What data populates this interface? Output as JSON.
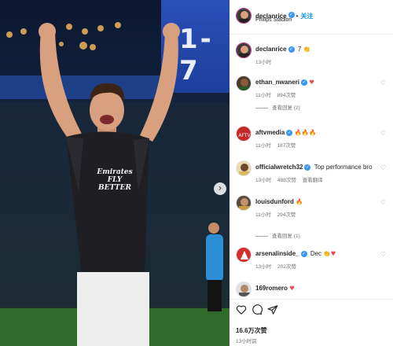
{
  "photo": {
    "scoreboard_text": "1-7",
    "jersey_sponsor": "Emirates FLY BETTER",
    "next_icon": "chevron-right-icon"
  },
  "header": {
    "username": "declanrice",
    "separator": "•",
    "follow_label": "关注",
    "location": "Philips Stadion"
  },
  "comments": [
    {
      "user": "declanrice",
      "text": "7",
      "emoji": "👏",
      "time": "13小时",
      "likes": "",
      "reply": "",
      "view_replies": ""
    },
    {
      "user": "ethan_nwaneri",
      "text": "",
      "emoji": "♥",
      "time": "11小时",
      "likes": "894次赞",
      "reply": "",
      "view_replies": "查看回复 (2)"
    },
    {
      "user": "aftvmedia",
      "text": "",
      "emoji": "🔥🔥🔥",
      "time": "11小时",
      "likes": "187次赞",
      "reply": "",
      "view_replies": ""
    },
    {
      "user": "officialwretch32",
      "text": "Top performance bro",
      "emoji": "",
      "time": "13小时",
      "likes": "488次赞",
      "reply": "查看翻译",
      "view_replies": ""
    },
    {
      "user": "louisdunford",
      "text": "",
      "emoji": "🔥",
      "time": "11小时",
      "likes": "294次赞",
      "reply": "",
      "view_replies": "查看回复 (1)"
    },
    {
      "user": "arsenalinside_",
      "text": "Dec",
      "emoji": "👏♥",
      "time": "13小时",
      "likes": "202次赞",
      "reply": "",
      "view_replies": ""
    },
    {
      "user": "169romero",
      "text": "",
      "emoji": "♥",
      "time": "",
      "likes": "",
      "reply": "",
      "view_replies": ""
    }
  ],
  "footer": {
    "likes": "16.6万次赞",
    "time_ago": "13小时前"
  },
  "icons": {
    "like": "heart-icon",
    "comment": "comment-icon",
    "share": "share-icon",
    "comment_like": "heart-outline-icon"
  },
  "colors": {
    "accent": "#0095f6",
    "verified": "#3897f0",
    "heart": "#ed4956"
  }
}
